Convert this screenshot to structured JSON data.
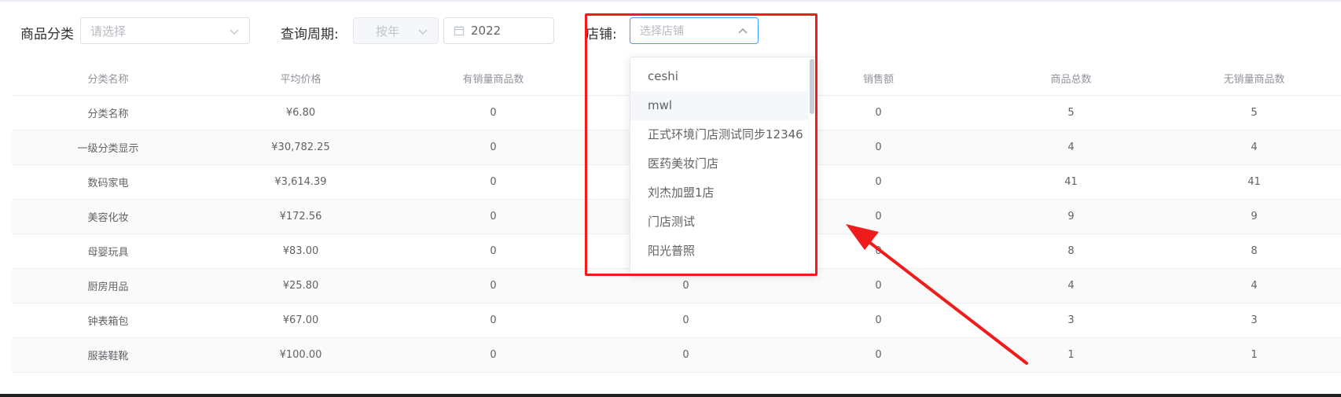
{
  "filters": {
    "category": {
      "label": "商品分类",
      "placeholder": "请选择"
    },
    "period": {
      "label": "查询周期:",
      "type_placeholder": "按年",
      "year_value": "2022"
    },
    "store": {
      "label": "店铺:",
      "placeholder": "选择店铺"
    }
  },
  "store_dropdown": {
    "options": [
      "ceshi",
      "mwl",
      "正式环境门店测试同步12346",
      "医药美妆门店",
      "刘杰加盟1店",
      "门店测试",
      "阳光普照"
    ],
    "hovered_index": 1
  },
  "table": {
    "headers": [
      "分类名称",
      "平均价格",
      "有销量商品数",
      "",
      "销售额",
      "商品总数",
      "无销量商品数"
    ],
    "rows": [
      [
        "分类名称",
        "¥6.80",
        "0",
        "",
        "0",
        "5",
        "5"
      ],
      [
        "一级分类显示",
        "¥30,782.25",
        "0",
        "",
        "0",
        "4",
        "4"
      ],
      [
        "数码家电",
        "¥3,614.39",
        "0",
        "",
        "0",
        "41",
        "41"
      ],
      [
        "美容化妆",
        "¥172.56",
        "0",
        "",
        "0",
        "9",
        "9"
      ],
      [
        "母婴玩具",
        "¥83.00",
        "0",
        "",
        "0",
        "8",
        "8"
      ],
      [
        "厨房用品",
        "¥25.80",
        "0",
        "0",
        "0",
        "4",
        "4"
      ],
      [
        "钟表箱包",
        "¥67.00",
        "0",
        "0",
        "0",
        "3",
        "3"
      ],
      [
        "服装鞋靴",
        "¥100.00",
        "0",
        "0",
        "0",
        "1",
        "1"
      ]
    ]
  },
  "colors": {
    "annotation": "#f01c1c",
    "focus": "#409eff"
  }
}
